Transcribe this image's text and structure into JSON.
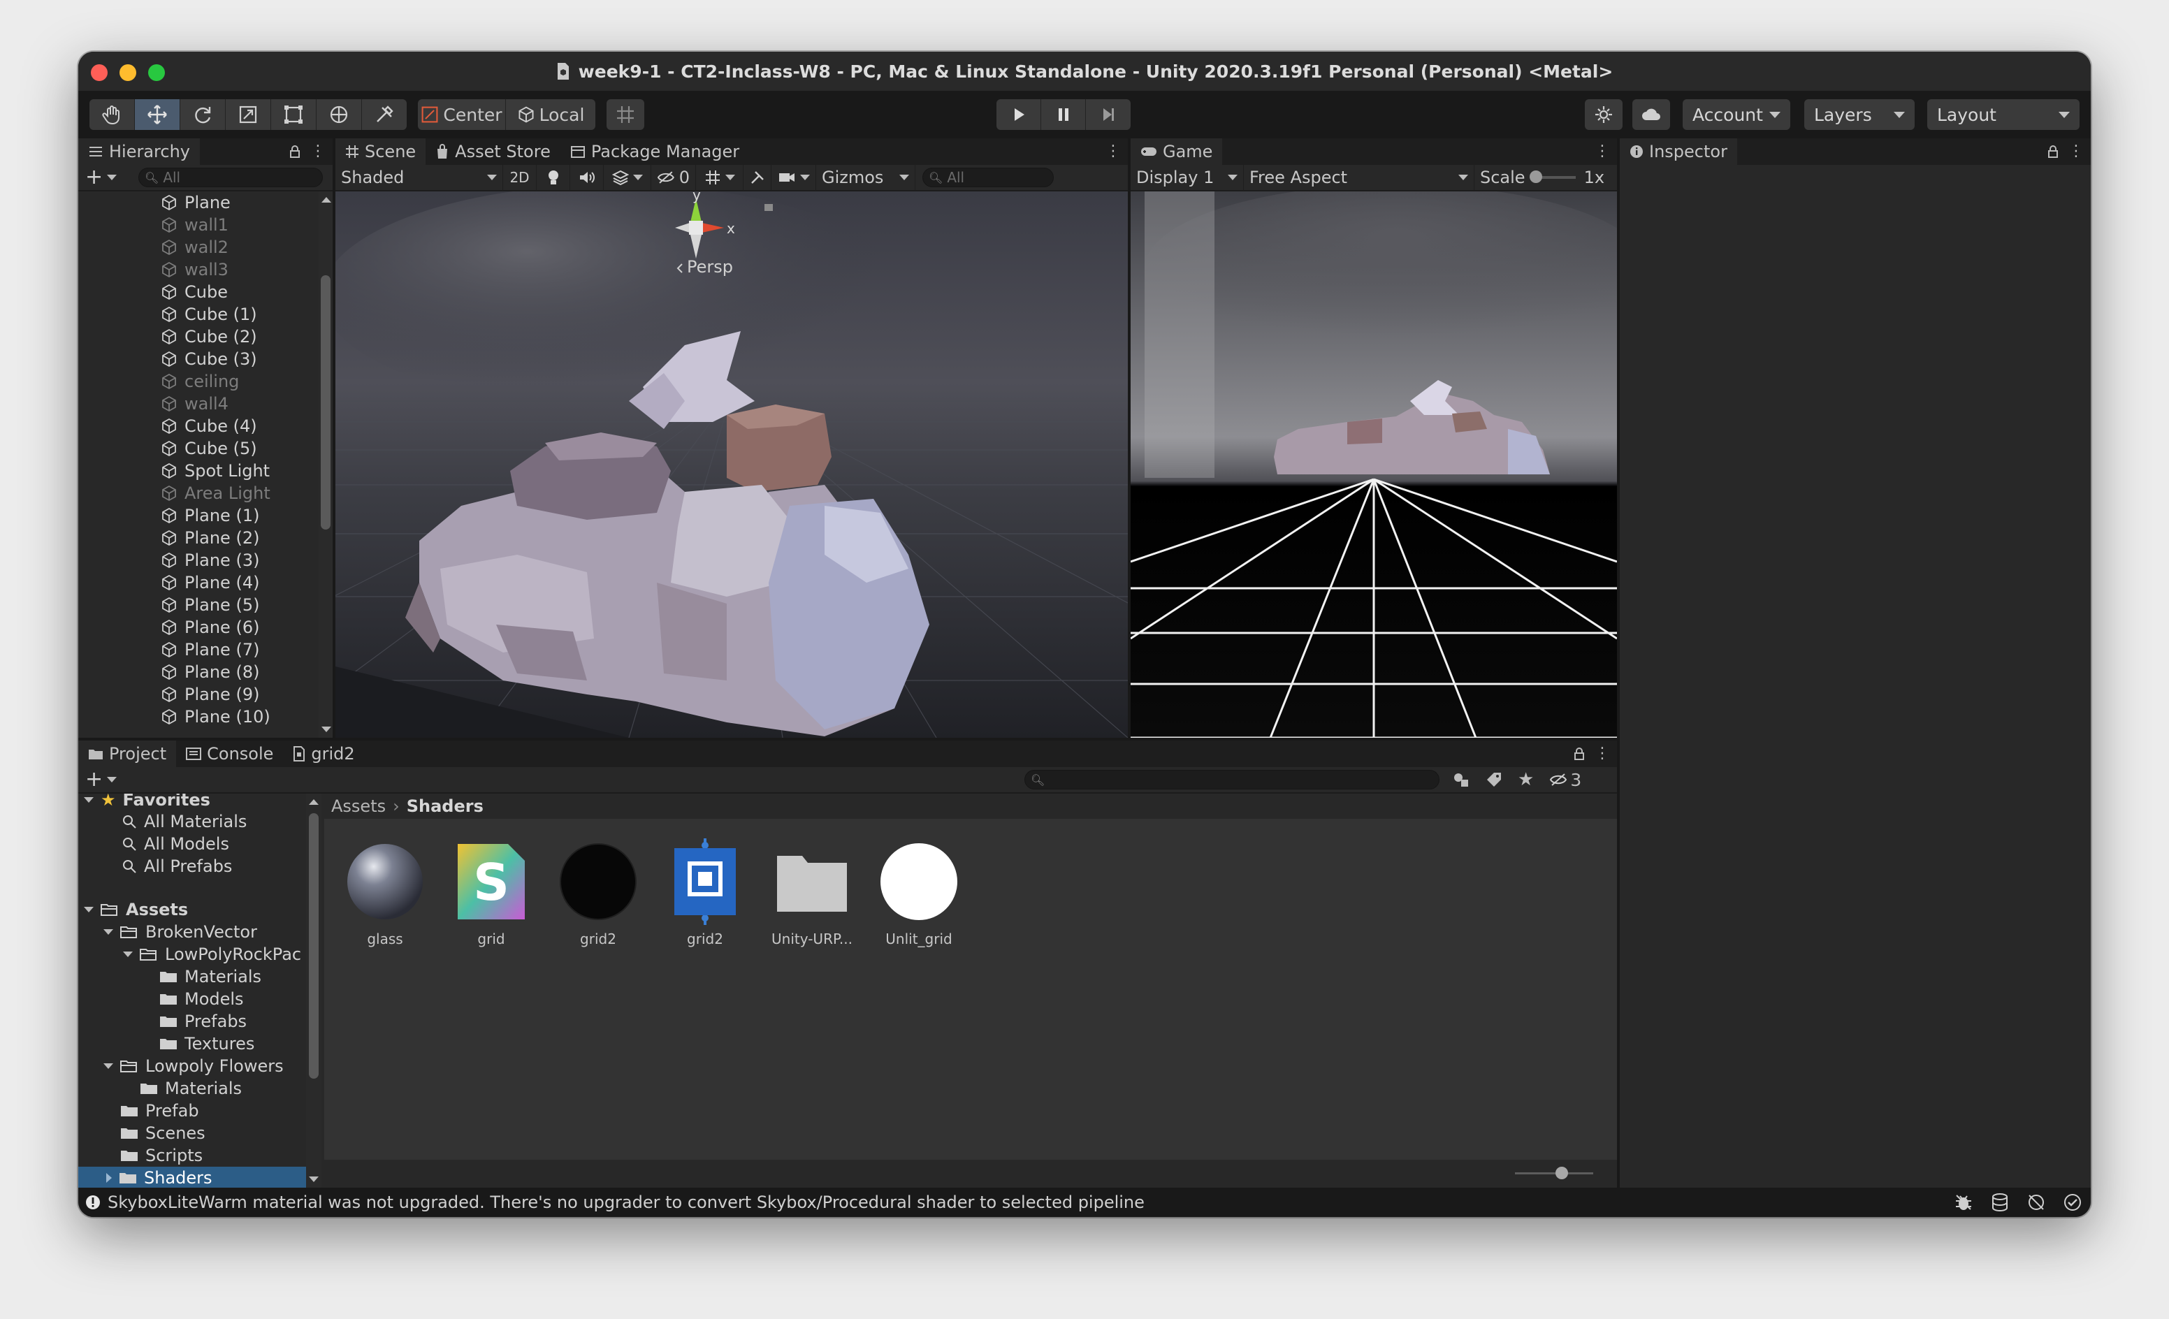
{
  "window": {
    "title": "week9-1 - CT2-Inclass-W8 - PC, Mac & Linux Standalone - Unity 2020.3.19f1 Personal (Personal) <Metal>"
  },
  "toolbar": {
    "tools": [
      "hand-tool",
      "move-tool",
      "rotate-tool",
      "scale-tool",
      "rect-tool",
      "transform-tool",
      "custom-tool"
    ],
    "pivot": "Center",
    "space": "Local",
    "account": "Account",
    "layers": "Layers",
    "layout": "Layout"
  },
  "hierarchy": {
    "tab": "Hierarchy",
    "search_placeholder": "All",
    "items": [
      {
        "label": "Plane",
        "dim": false
      },
      {
        "label": "wall1",
        "dim": true
      },
      {
        "label": "wall2",
        "dim": true
      },
      {
        "label": "wall3",
        "dim": true
      },
      {
        "label": "Cube",
        "dim": false
      },
      {
        "label": "Cube (1)",
        "dim": false
      },
      {
        "label": "Cube (2)",
        "dim": false
      },
      {
        "label": "Cube (3)",
        "dim": false
      },
      {
        "label": "ceiling",
        "dim": true
      },
      {
        "label": "wall4",
        "dim": true
      },
      {
        "label": "Cube (4)",
        "dim": false
      },
      {
        "label": "Cube (5)",
        "dim": false
      },
      {
        "label": "Spot Light",
        "dim": false
      },
      {
        "label": "Area Light",
        "dim": true
      },
      {
        "label": "Plane (1)",
        "dim": false
      },
      {
        "label": "Plane (2)",
        "dim": false
      },
      {
        "label": "Plane (3)",
        "dim": false
      },
      {
        "label": "Plane (4)",
        "dim": false
      },
      {
        "label": "Plane (5)",
        "dim": false
      },
      {
        "label": "Plane (6)",
        "dim": false
      },
      {
        "label": "Plane (7)",
        "dim": false
      },
      {
        "label": "Plane (8)",
        "dim": false
      },
      {
        "label": "Plane (9)",
        "dim": false
      },
      {
        "label": "Plane (10)",
        "dim": false
      }
    ]
  },
  "scene": {
    "tabs": [
      "Scene",
      "Asset Store",
      "Package Manager"
    ],
    "shading": "Shaded",
    "mode_2d": "2D",
    "hidden_count": "0",
    "gizmos": "Gizmos",
    "search_placeholder": "All",
    "axis_y": "y",
    "axis_x": "x",
    "projection": "Persp"
  },
  "game": {
    "tab": "Game",
    "display": "Display 1",
    "aspect": "Free Aspect",
    "scale_label": "Scale",
    "scale_value": "1x"
  },
  "inspector": {
    "tab": "Inspector"
  },
  "project": {
    "tabs": [
      "Project",
      "Console",
      "grid2"
    ],
    "favorites": {
      "label": "Favorites",
      "items": [
        "All Materials",
        "All Models",
        "All Prefabs"
      ]
    },
    "assets_label": "Assets",
    "tree": [
      {
        "label": "BrokenVector",
        "level": 1,
        "open": true
      },
      {
        "label": "LowPolyRockPac",
        "level": 2,
        "open": true
      },
      {
        "label": "Materials",
        "level": 3
      },
      {
        "label": "Models",
        "level": 3
      },
      {
        "label": "Prefabs",
        "level": 3
      },
      {
        "label": "Textures",
        "level": 3
      },
      {
        "label": "Lowpoly Flowers",
        "level": 1,
        "open": true
      },
      {
        "label": "Materials",
        "level": 2
      },
      {
        "label": "Prefab",
        "level": 1
      },
      {
        "label": "Scenes",
        "level": 1
      },
      {
        "label": "Scripts",
        "level": 1
      },
      {
        "label": "Shaders",
        "level": 1,
        "selected": true
      }
    ],
    "breadcrumb": [
      "Assets",
      "Shaders"
    ],
    "hidden_packages": "3",
    "assets": [
      {
        "name": "glass",
        "icon": "sphere-material"
      },
      {
        "name": "grid",
        "icon": "shader-graph"
      },
      {
        "name": "grid2",
        "icon": "dark-material"
      },
      {
        "name": "grid2",
        "icon": "shader-asset"
      },
      {
        "name": "Unity-URP...",
        "icon": "folder"
      },
      {
        "name": "Unlit_grid",
        "icon": "white-material"
      }
    ]
  },
  "status": {
    "message": "SkyboxLiteWarm material was not upgraded. There's no upgrader to convert Skybox/Procedural shader to selected pipeline"
  },
  "colors": {
    "accent_selection": "#2c5d87",
    "close": "#fe5f57",
    "minimize": "#febc2e",
    "zoom": "#28c840",
    "axis_x": "#e04a2f",
    "axis_y": "#8ed33b"
  }
}
